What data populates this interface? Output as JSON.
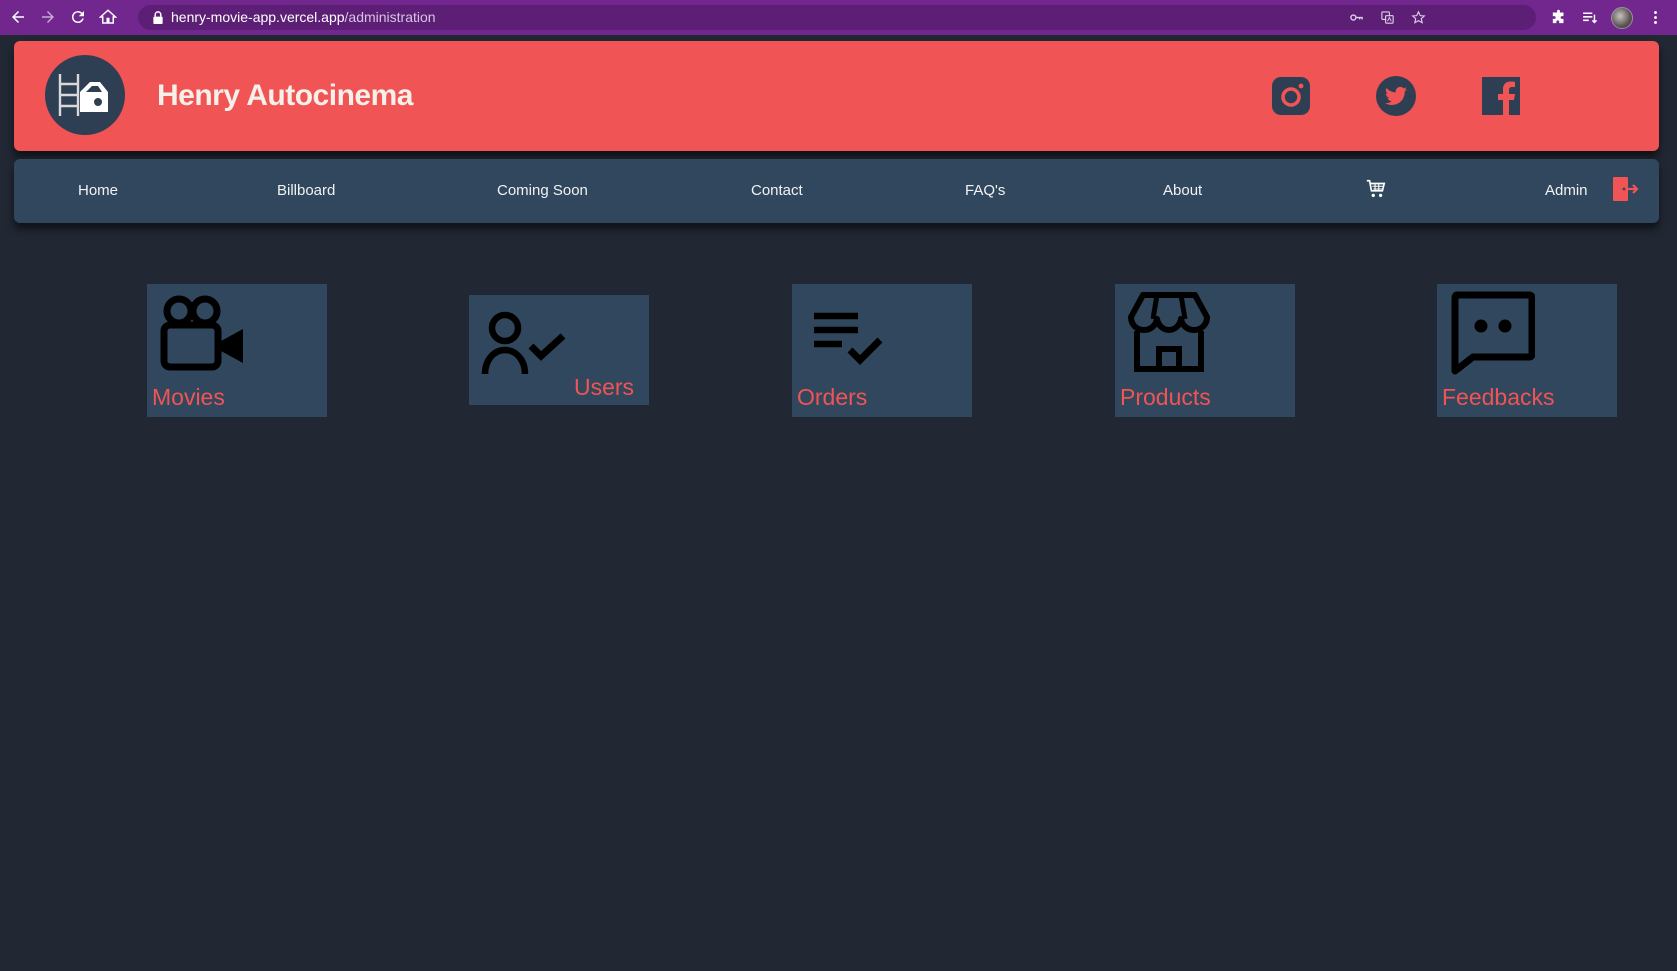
{
  "browser": {
    "url_host": "henry-movie-app.vercel.app",
    "url_path": "/administration",
    "icons": {
      "back": "back-arrow-icon",
      "forward": "forward-arrow-icon",
      "reload": "reload-icon",
      "home": "home-icon",
      "lock": "lock-icon",
      "password": "key-icon",
      "translate": "translate-icon",
      "bookmark": "star-icon",
      "extensions": "puzzle-icon",
      "reading_list": "reading-list-icon",
      "profile": "profile-avatar",
      "menu": "kebab-menu-icon"
    }
  },
  "header": {
    "title": "Henry Autocinema",
    "logo": "film-car-logo",
    "social": [
      "instagram-icon",
      "twitter-icon",
      "facebook-icon"
    ],
    "colors": {
      "header_bg": "#f05454",
      "logo_bg": "#2e3e53"
    }
  },
  "nav": {
    "items": [
      "Home",
      "Billboard",
      "Coming Soon",
      "Contact",
      "FAQ's",
      "About"
    ],
    "cart_icon": "cart-icon",
    "admin_label": "Admin",
    "logout_icon": "logout-door-icon",
    "colors": {
      "nav_bg": "#30475e",
      "nav_text": "#f2f2f2"
    }
  },
  "admin": {
    "cards": [
      {
        "label": "Movies",
        "icon": "movie-camera-icon"
      },
      {
        "label": "Users",
        "icon": "user-check-icon"
      },
      {
        "label": "Orders",
        "icon": "list-check-icon"
      },
      {
        "label": "Products",
        "icon": "store-icon"
      },
      {
        "label": "Feedbacks",
        "icon": "chat-feedback-icon"
      }
    ],
    "colors": {
      "card_bg": "#30475e",
      "label": "#f05454",
      "page_bg": "#212733"
    }
  }
}
